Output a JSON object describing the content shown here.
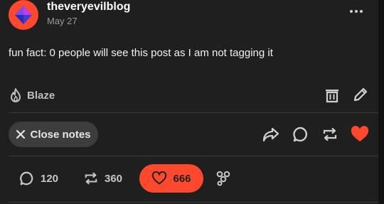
{
  "post": {
    "blog_name": "theveryevilblog",
    "date": "May 27",
    "text": "fun fact: 0 people will see this post as I am not tagging it",
    "more_label": "..."
  },
  "actions": {
    "blaze_label": "Blaze",
    "close_notes_label": "Close notes"
  },
  "stats": {
    "replies": "120",
    "reblogs": "360",
    "likes": "666"
  },
  "colors": {
    "accent": "#ff492f",
    "background": "#1f1f1f",
    "pill": "#3d3d3d"
  },
  "icons": [
    "avatar",
    "more-icon",
    "flame-icon",
    "trash-icon",
    "pencil-icon",
    "close-icon",
    "share-icon",
    "reply-icon",
    "reblog-icon",
    "heart-icon",
    "reactions-icon"
  ]
}
